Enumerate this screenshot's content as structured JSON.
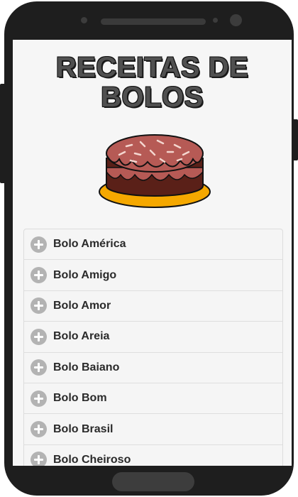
{
  "app": {
    "title": "RECEITAS DE BOLOS",
    "header_icon": "cake-illustration"
  },
  "recipes": {
    "expand_icon": "plus-circle-icon",
    "items": [
      {
        "label": "Bolo América"
      },
      {
        "label": "Bolo Amigo"
      },
      {
        "label": "Bolo Amor"
      },
      {
        "label": "Bolo Areia"
      },
      {
        "label": "Bolo Baiano"
      },
      {
        "label": "Bolo Bom"
      },
      {
        "label": "Bolo Brasil"
      },
      {
        "label": "Bolo Cheiroso"
      }
    ]
  },
  "colors": {
    "cake_sponge": "#5a2018",
    "cake_frosting": "#b65a55",
    "cake_plate": "#f5a800",
    "icon_grey": "#b3b3b3"
  }
}
